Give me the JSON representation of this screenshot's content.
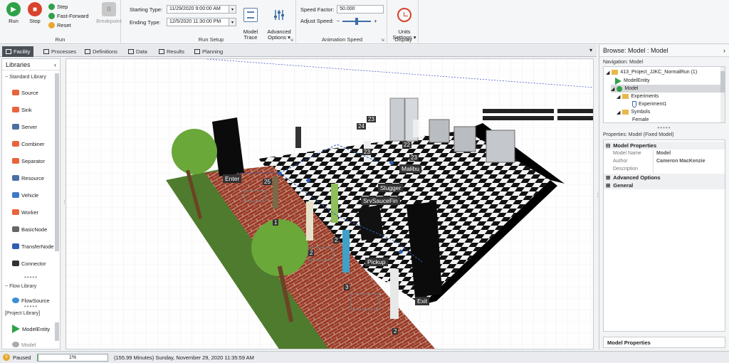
{
  "ribbon": {
    "run_group": {
      "label": "Run",
      "run": "Run",
      "stop": "Stop",
      "step": "Step",
      "fast_forward": "Fast-Forward",
      "reset": "Reset",
      "breakpoint": "Breakpoint"
    },
    "run_setup": {
      "label": "Run Setup",
      "starting_label": "Starting Type:",
      "starting_value": "11/29/2020 9:00:00 AM",
      "ending_label": "Ending Type:",
      "ending_value": "12/5/2020 11:30:00 PM",
      "model_trace": "Model\nTrace",
      "advanced_options": "Advanced\nOptions ▾"
    },
    "animation_speed": {
      "label": "Animation Speed",
      "speed_factor_label": "Speed Factor:",
      "speed_factor_value": "50.000",
      "adjust_speed_label": "Adjust Speed:",
      "minus": "−",
      "plus": "+"
    },
    "display": {
      "label": "Display",
      "units_settings": "Units\nSettings ▾"
    }
  },
  "tabs": [
    {
      "label": "Facility"
    },
    {
      "label": "Processes"
    },
    {
      "label": "Definitions"
    },
    {
      "label": "Data"
    },
    {
      "label": "Results"
    },
    {
      "label": "Planning"
    }
  ],
  "libraries": {
    "title": "Libraries",
    "standard_label": "Standard Library",
    "standard_items": [
      {
        "label": "Source",
        "color": "#e8643c"
      },
      {
        "label": "Sink",
        "color": "#e8643c"
      },
      {
        "label": "Server",
        "color": "#4a6fa5"
      },
      {
        "label": "Combiner",
        "color": "#e8643c"
      },
      {
        "label": "Separator",
        "color": "#e8643c"
      },
      {
        "label": "Resource",
        "color": "#4a6fa5"
      },
      {
        "label": "Vehicle",
        "color": "#3f78c8"
      },
      {
        "label": "Worker",
        "color": "#e8643c"
      },
      {
        "label": "BasicNode",
        "color": "#666666"
      },
      {
        "label": "TransferNode",
        "color": "#2f5fb3"
      },
      {
        "label": "Connector",
        "color": "#333333"
      }
    ],
    "flow_label": "Flow Library",
    "flow_items": [
      {
        "label": "FlowSource"
      }
    ],
    "project_label": "[Project Library]",
    "project_items": [
      {
        "label": "ModelEntity"
      },
      {
        "label": "Model"
      }
    ]
  },
  "scene": {
    "labels": {
      "enter": "Enter",
      "malibu": "Malibu",
      "slugger": "Slugger",
      "srv_sauce_fin": "SrvSauceFin",
      "pickup": "Pickup",
      "exit": "Exit"
    },
    "counters": {
      "c23a": "23",
      "c24": "24",
      "c23b": "23",
      "c22": "22",
      "c23c": "23",
      "c25": "25",
      "c1": "1",
      "c2a": "2",
      "c2b": "2",
      "c3": "3",
      "c2c": "2"
    }
  },
  "right_panel": {
    "browse_title": "Browse: Model : Model",
    "nav_label": "Navigation: Model",
    "tree": {
      "project": "413_Project_JJKC_NormalRun (1)",
      "model_entity": "ModelEntity",
      "model": "Model",
      "experiments": "Experiments",
      "experiment1": "Experiment1",
      "symbols": "Symbols",
      "female": "Female"
    },
    "props_label": "Properties: Model (Fixed Model)",
    "model_properties_group": "Model Properties",
    "rows": [
      {
        "key": "Model Name",
        "value": "Model"
      },
      {
        "key": "Author",
        "value": "Cameron MacKenzie"
      },
      {
        "key": "Description",
        "value": ""
      }
    ],
    "advanced_group": "Advanced Options",
    "general_group": "General",
    "footer": "Model Properties"
  },
  "status": {
    "state": "Paused",
    "progress": "1%",
    "progress_value": 0.01,
    "time_text": "(155.99 Minutes) Sunday, November 29, 2020 11:35:59 AM"
  },
  "colors": {
    "run_green": "#2fa14a",
    "stop_red": "#d9422c",
    "active_tab": "#4a5058",
    "grass": "#4f7b2e",
    "brick": "#9b3b28"
  }
}
